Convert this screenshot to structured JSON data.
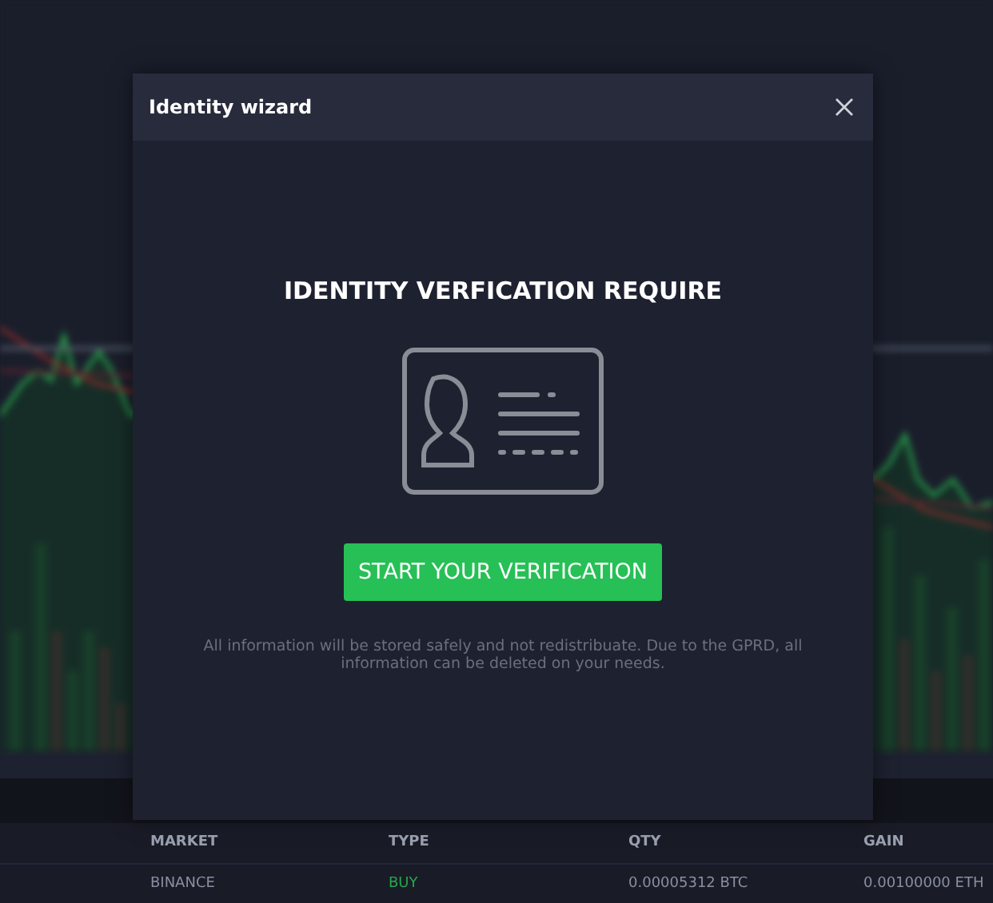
{
  "background_table": {
    "columns": [
      "MARKET",
      "TYPE",
      "QTY",
      "GAIN"
    ],
    "rows": [
      {
        "cells": [
          {
            "text": "BINANCE",
            "color": "#8a8fa0"
          },
          {
            "text": "BUY",
            "color": "#27a84d"
          },
          {
            "text": "0.00005312 BTC",
            "color": "#8a8fa0"
          },
          {
            "text": "0.00100000 ETH",
            "color": "#8a8fa0"
          }
        ]
      }
    ]
  },
  "dialog": {
    "title": "Identity wizard",
    "heading": "IDENTITY VERFICATION REQUIRE",
    "button": "START YOUR VERIFICATION",
    "note": "All information will be stored safely and not redistribuate. Due to the GPRD, all information can be deleted on your needs."
  }
}
